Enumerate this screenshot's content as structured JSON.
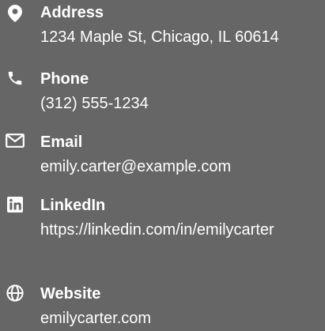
{
  "contacts": [
    {
      "icon": "map-pin-icon",
      "label": "Address",
      "value": "1234 Maple St, Chicago, IL 60614"
    },
    {
      "icon": "phone-icon",
      "label": "Phone",
      "value": "(312) 555-1234"
    },
    {
      "icon": "envelope-icon",
      "label": "Email",
      "value": "emily.carter@example.com"
    },
    {
      "icon": "linkedin-icon",
      "label": "LinkedIn",
      "value": "https://linkedin.com/in/emilycarter"
    },
    {
      "icon": "globe-icon",
      "label": "Website",
      "value": "emilycarter.com"
    }
  ],
  "colors": {
    "background": "#666666",
    "text": "#ffffff"
  }
}
